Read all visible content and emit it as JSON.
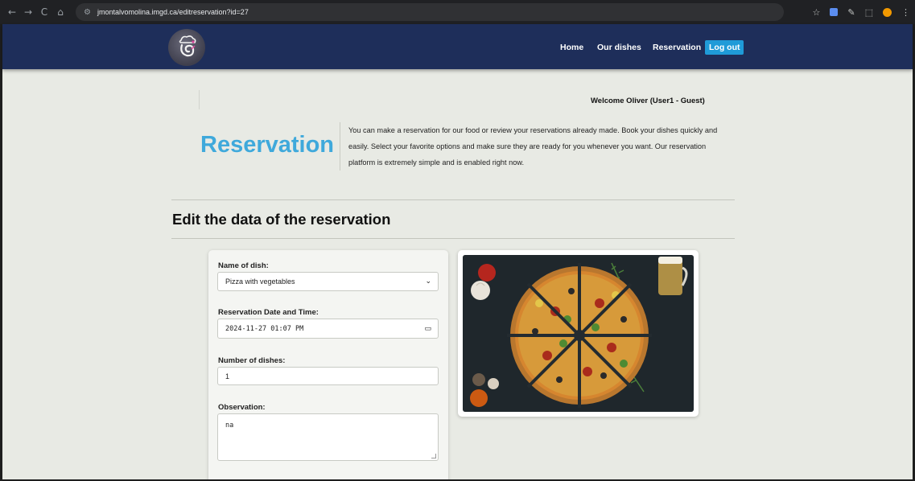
{
  "browser": {
    "url": "jmontalvomolina.imgd.ca/editreservation?id=27",
    "nav_icons": [
      "back-icon",
      "forward-icon",
      "reload-icon",
      "home-icon"
    ],
    "nav_glyphs": [
      "←",
      "→",
      "C",
      "⌂"
    ],
    "tune_glyph": "⚙",
    "tool_glyphs": [
      "☆",
      "✎",
      "⬚",
      "⋮"
    ]
  },
  "header": {
    "nav": [
      {
        "label": "Home"
      },
      {
        "label": "Our dishes"
      },
      {
        "label": "Reservation"
      },
      {
        "label": "Log out"
      }
    ],
    "colors": {
      "bar": "#1e2e5a",
      "logout": "#1f9bd8"
    }
  },
  "welcome": "Welcome Oliver (User1 - Guest)",
  "hero": {
    "title": "Reservation",
    "description": "You can make a reservation for our food or review your reservations already made. Book your dishes quickly and easily. Select your favorite options and make sure they are ready for you whenever you want. Our reservation platform is extremely simple and is enabled right now."
  },
  "section_title": "Edit the data of the reservation",
  "form": {
    "dish_label": "Name of dish:",
    "dish_value": "Pizza with vegetables",
    "date_label": "Reservation Date and Time:",
    "date_value": "2024-11-27 01:07 PM",
    "quantity_label": "Number of dishes:",
    "quantity_value": "1",
    "observation_label": "Observation:",
    "observation_value": "na",
    "select_glyph": "⌄",
    "calendar_glyph": "▭"
  }
}
